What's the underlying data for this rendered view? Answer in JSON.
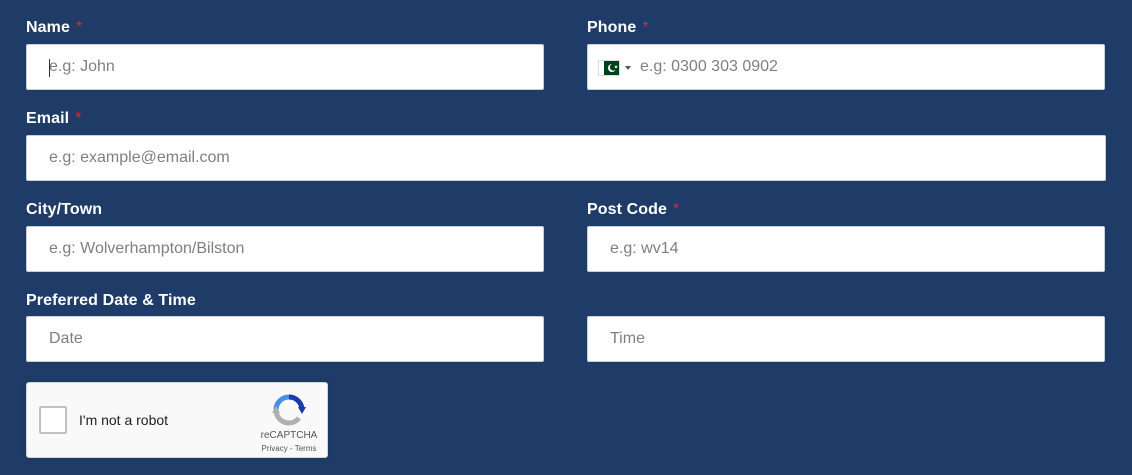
{
  "form": {
    "name": {
      "label": "Name",
      "required": "*",
      "placeholder": "e.g: John"
    },
    "phone": {
      "label": "Phone",
      "required": "*",
      "placeholder": "e.g: 0300 303 0902",
      "country_flag": "pakistan-flag"
    },
    "email": {
      "label": "Email",
      "required": "*",
      "placeholder": "e.g: example@email.com"
    },
    "city": {
      "label": "City/Town",
      "placeholder": "e.g: Wolverhampton/Bilston"
    },
    "postcode": {
      "label": "Post Code",
      "required": "*",
      "placeholder": "e.g: wv14"
    },
    "datetime": {
      "label": "Preferred Date & Time",
      "date_placeholder": "Date",
      "time_placeholder": "Time"
    }
  },
  "recaptcha": {
    "checkbox_label": "I'm not a robot",
    "brand": "reCAPTCHA",
    "privacy": "Privacy",
    "separator": " - ",
    "terms": "Terms"
  },
  "colors": {
    "background": "#1f3b67",
    "required": "#e02a2a",
    "label": "#ffffff"
  }
}
